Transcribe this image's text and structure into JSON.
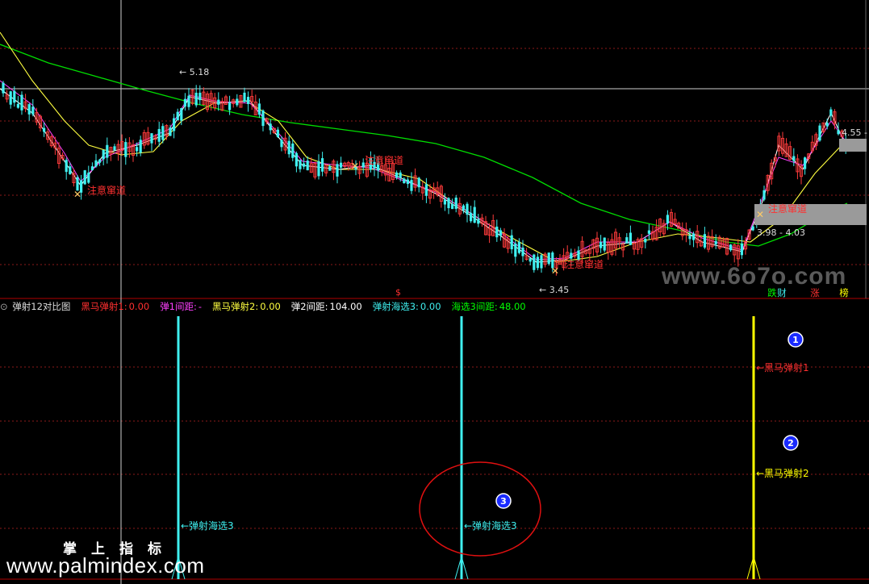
{
  "colors": {
    "background": "#000000",
    "grid": "#8b1a1a",
    "up": "#ff3b3b",
    "down": "#3ff0f0",
    "ma_white": "#ffffff",
    "ma_yellow": "#ffff40",
    "ma_magenta": "#ff40ff",
    "ma_green": "#00dd00",
    "cyan": "#3ff0f0",
    "yellow": "#ffff00",
    "red": "#ff3030",
    "magenta": "#ff40ff",
    "green": "#00ff00"
  },
  "main_chart": {
    "price_labels": {
      "high": "5.18",
      "low": "3.45",
      "right": "4.55",
      "range": "3.98 - 4.03"
    },
    "signal_label": "注意窜道",
    "marker_s": "$"
  },
  "right_buttons": [
    {
      "label": "跌",
      "color": "#00ff00"
    },
    {
      "label": "财",
      "color": "#3ff0f0"
    },
    {
      "label": "涨",
      "color": "#ff3030"
    },
    {
      "label": "榜",
      "color": "#ffff00"
    }
  ],
  "indicator_header": {
    "icon": "circle-arrow-icon",
    "title": "弹射12对比图",
    "fields": [
      {
        "label": "黑马弹射1:",
        "value": "0.00",
        "color": "#ff3030"
      },
      {
        "label": "弹1间距:",
        "value": "-",
        "color": "#ff40ff"
      },
      {
        "label": "黑马弹射2:",
        "value": "0.00",
        "color": "#ffff40"
      },
      {
        "label": "弹2间距:",
        "value": "104.00",
        "color": "#ffffff"
      },
      {
        "label": "弹射海选3:",
        "value": "0.00",
        "color": "#3ff0f0"
      },
      {
        "label": "海选3间距:",
        "value": "48.00",
        "color": "#00ff00"
      }
    ]
  },
  "indicator": {
    "line_labels": {
      "heima1": "←黑马弹射1",
      "heima2": "←黑马弹射2",
      "haixuan3": "←弹射海选3"
    },
    "badges": [
      "1",
      "2",
      "3"
    ]
  },
  "watermarks": {
    "site_top": "www.6o7o.com",
    "cn_label": "掌上指标",
    "site_bottom": "www.palmindex.com"
  }
}
